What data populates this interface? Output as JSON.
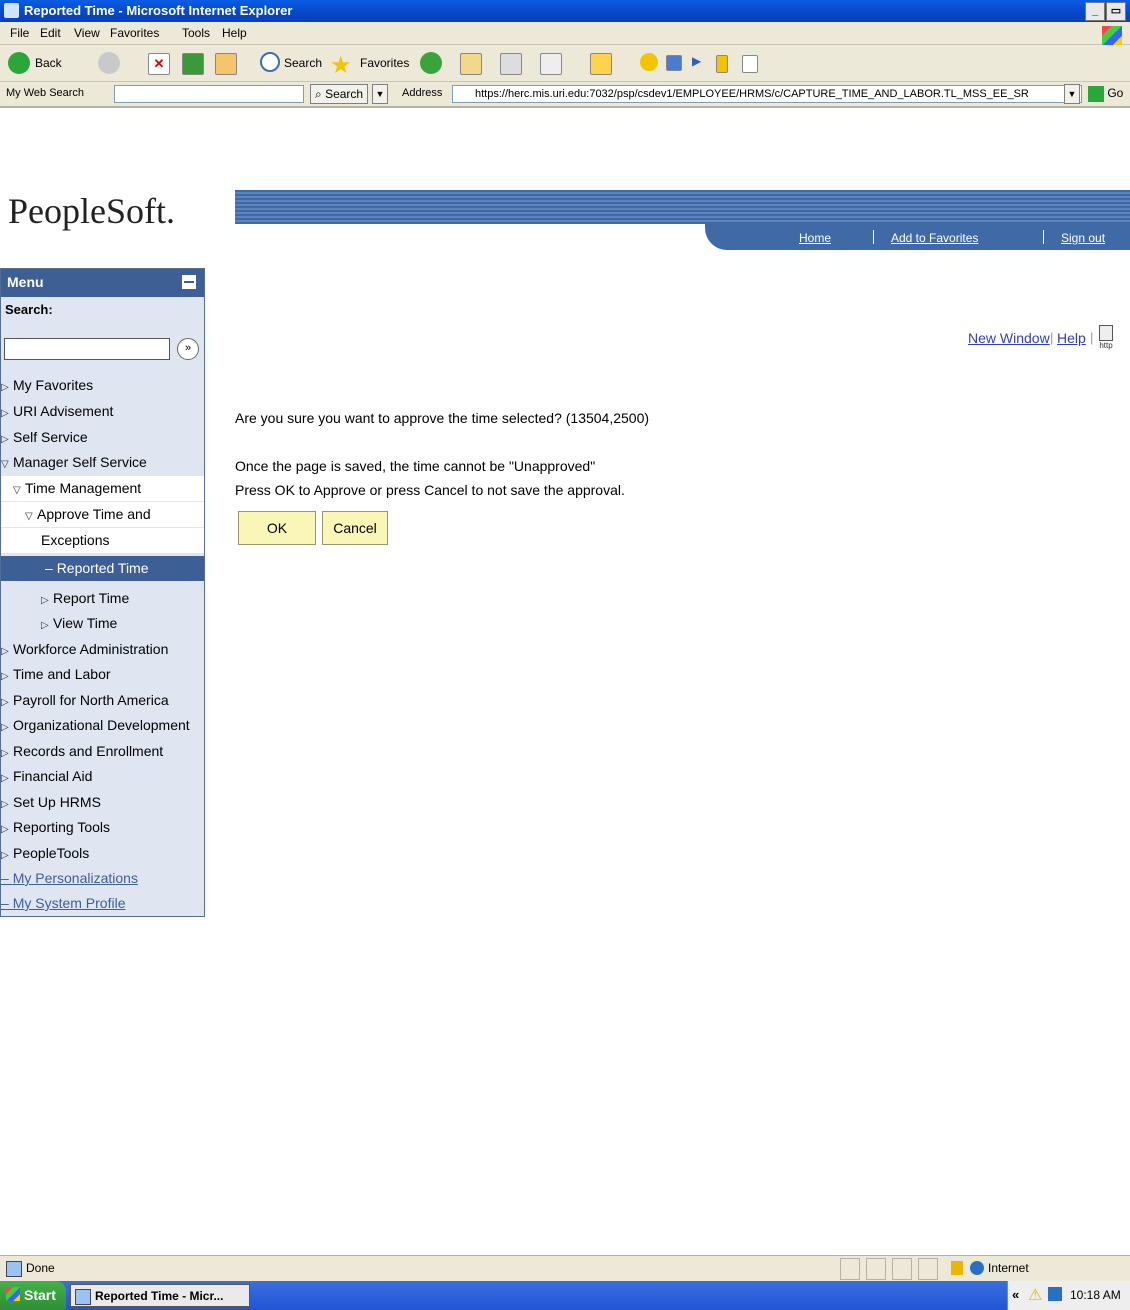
{
  "window": {
    "title": "Reported Time - Microsoft Internet Explorer"
  },
  "menubar": [
    "File",
    "Edit",
    "View",
    "Favorites",
    "Tools",
    "Help"
  ],
  "toolbar": {
    "back": "Back",
    "search": "Search",
    "favorites": "Favorites"
  },
  "addressbar": {
    "websearch_label": "My Web Search",
    "search_button": "Search",
    "address_label": "Address",
    "url": "https://herc.mis.uri.edu:7032/psp/csdev1/EMPLOYEE/HRMS/c/CAPTURE_TIME_AND_LABOR.TL_MSS_EE_SR",
    "go_label": "Go"
  },
  "header": {
    "logo": "PeopleSoft.",
    "links": {
      "home": "Home",
      "favorites": "Add to Favorites",
      "signout": "Sign out"
    }
  },
  "menu": {
    "title": "Menu",
    "search_label": "Search:",
    "items": [
      "My Favorites",
      "URI Advisement",
      "Self Service",
      "Manager Self Service",
      "Time Management",
      "Approve Time and",
      "Exceptions",
      "Reported Time",
      "Report Time",
      "View Time",
      "Workforce Administration",
      "Time and Labor",
      "Payroll for North America",
      "Organizational Development",
      "Records and Enrollment",
      "Financial Aid",
      "Set Up HRMS",
      "Reporting Tools",
      "PeopleTools",
      "My Personalizations",
      "My System Profile"
    ]
  },
  "content": {
    "new_window": "New Window",
    "help": "Help",
    "http_label": "http",
    "confirm_question": "Are you sure you want to approve the time selected? (13504,2500)",
    "message_line1": "Once the page is saved, the time cannot be \"Unapproved\"",
    "message_line2": "Press OK to Approve or press Cancel to not save the approval.",
    "ok_label": "OK",
    "cancel_label": "Cancel"
  },
  "statusbar": {
    "status": "Done",
    "zone": "Internet"
  },
  "taskbar": {
    "start": "Start",
    "task": "Reported Time - Micr...",
    "time": "10:18 AM"
  }
}
